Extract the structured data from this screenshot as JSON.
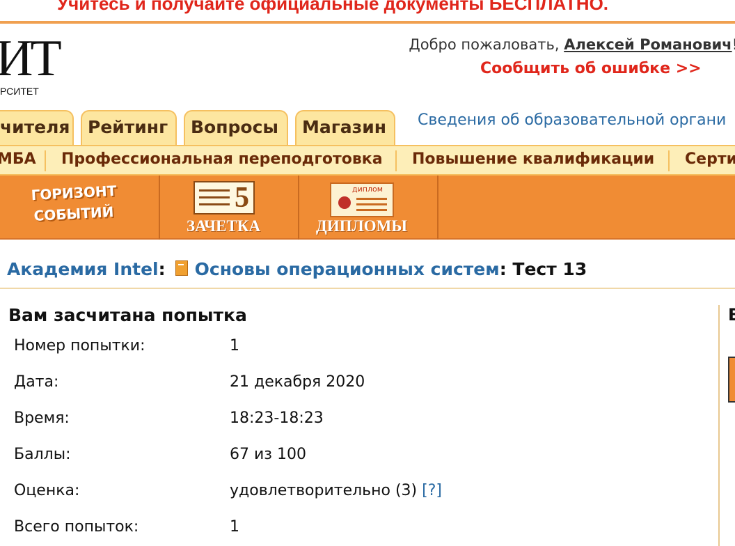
{
  "banner": {
    "text": "Учитесь и получайте официальные документы БЕСПЛАТНО."
  },
  "logo": {
    "letters": "ИТ",
    "subtitle": "РСИТЕТ"
  },
  "header": {
    "welcome_prefix": "Добро пожаловать, ",
    "user_name": "Алексей Романович",
    "welcome_suffix": "!",
    "report_error": "Сообщить об ошибке >>"
  },
  "tabs": [
    {
      "label": "чителя"
    },
    {
      "label": "Рейтинг"
    },
    {
      "label": "Вопросы"
    },
    {
      "label": "Магазин"
    }
  ],
  "org_info_link": "Сведения об образовательной органи",
  "menu": [
    {
      "label": "МБА"
    },
    {
      "label": "Профессиональная переподготовка"
    },
    {
      "label": "Повышение квалификации"
    },
    {
      "label": "Серти"
    }
  ],
  "orange_bar": {
    "horizon_line1": "ГОРИЗОНТ",
    "horizon_line2": "СОБЫТИЙ",
    "zachetka_digit": "5",
    "zachetka_label": "ЗАЧЕТКА",
    "diploma_tag": "диплом",
    "diplomas_label": "ДИПЛОМЫ"
  },
  "breadcrumb": {
    "academy": "Академия Intel",
    "course": "Основы операционных систем",
    "test": "Тест 13",
    "separator": ":"
  },
  "result": {
    "title": "Вам засчитана попытка",
    "rows": [
      {
        "label": "Номер попытки:",
        "value": "1"
      },
      {
        "label": "Дата:",
        "value": "21 декабря 2020"
      },
      {
        "label": "Время:",
        "value": "18:23-18:23"
      },
      {
        "label": "Баллы:",
        "value": "67 из 100"
      },
      {
        "label": "Оценка:",
        "value": "удовлетворительно (3)",
        "help": "[?]"
      },
      {
        "label": "Всего попыток:",
        "value": "1"
      }
    ]
  },
  "right_panel": {
    "letter": "В"
  },
  "colors": {
    "banner_red": "#e0261b",
    "link_blue": "#2a6aa3",
    "tab_bg": "#fde6a0",
    "orange": "#f08c34"
  },
  "icons": [
    "book-icon",
    "zachetka-icon",
    "diploma-icon"
  ]
}
